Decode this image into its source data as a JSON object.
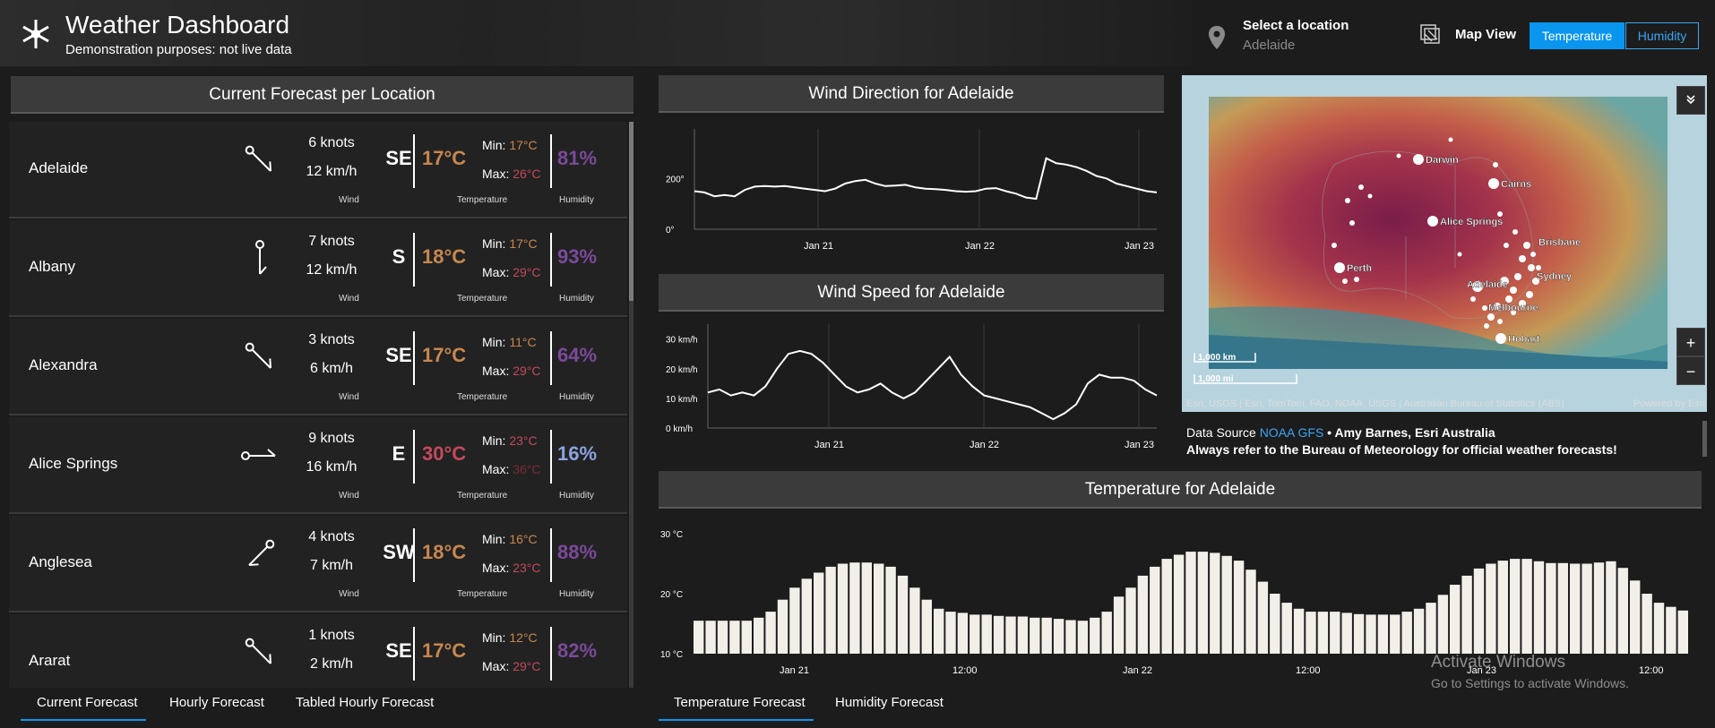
{
  "header": {
    "title": "Weather Dashboard",
    "subtitle": "Demonstration purposes: not live data",
    "logo_icon": "snowflake-sun-icon",
    "location_label": "Select a location",
    "location_value": "Adelaide",
    "map_view_label": "Map View",
    "toggle_temperature": "Temperature",
    "toggle_humidity": "Humidity",
    "accent_color": "#0a95ef"
  },
  "forecast": {
    "title": "Current Forecast per Location",
    "wind_caption": "Wind",
    "temp_caption": "Temperature",
    "hum_caption": "Humidity",
    "min_label": "Min:",
    "max_label": "Max:",
    "locations": [
      {
        "name": "Adelaide",
        "knots": "6 knots",
        "kmh": "12 km/h",
        "dir": "SE",
        "temp": "17°C",
        "min": "17°C",
        "max": "26°C",
        "hum": "81%"
      },
      {
        "name": "Albany",
        "knots": "7 knots",
        "kmh": "12 km/h",
        "dir": "S",
        "temp": "18°C",
        "min": "17°C",
        "max": "29°C",
        "hum": "93%"
      },
      {
        "name": "Alexandra",
        "knots": "3 knots",
        "kmh": "6 km/h",
        "dir": "SE",
        "temp": "17°C",
        "min": "11°C",
        "max": "29°C",
        "hum": "64%"
      },
      {
        "name": "Alice Springs",
        "knots": "9 knots",
        "kmh": "16 km/h",
        "dir": "E",
        "temp": "30°C",
        "min": "23°C",
        "max": "36°C",
        "hum": "16%"
      },
      {
        "name": "Anglesea",
        "knots": "4 knots",
        "kmh": "7 km/h",
        "dir": "SW",
        "temp": "18°C",
        "min": "16°C",
        "max": "23°C",
        "hum": "88%"
      },
      {
        "name": "Ararat",
        "knots": "1 knots",
        "kmh": "2 km/h",
        "dir": "SE",
        "temp": "17°C",
        "min": "12°C",
        "max": "29°C",
        "hum": "82%"
      }
    ]
  },
  "left_tabs": [
    "Current Forecast",
    "Hourly Forecast",
    "Tabled Hourly Forecast"
  ],
  "right_tabs": [
    "Temperature Forecast",
    "Humidity Forecast"
  ],
  "charts": {
    "wind_direction_title": "Wind Direction for Adelaide",
    "wind_speed_title": "Wind Speed for Adelaide",
    "temperature_title": "Temperature for Adelaide"
  },
  "chart_data": [
    {
      "type": "line",
      "title": "Wind Direction for Adelaide",
      "y_ticks": [
        "200°",
        "0°"
      ],
      "x_ticks": [
        "Jan 21",
        "Jan 22",
        "Jan 23"
      ],
      "ylim": [
        0,
        360
      ],
      "values": [
        150,
        145,
        130,
        135,
        130,
        155,
        168,
        170,
        168,
        170,
        165,
        160,
        155,
        150,
        160,
        180,
        190,
        195,
        180,
        170,
        172,
        175,
        165,
        160,
        158,
        155,
        150,
        148,
        150,
        160,
        162,
        150,
        140,
        125,
        120,
        280,
        260,
        255,
        245,
        230,
        210,
        200,
        180,
        170,
        160,
        150,
        145
      ]
    },
    {
      "type": "line",
      "title": "Wind Speed for Adelaide",
      "y_ticks": [
        "30 km/h",
        "20 km/h",
        "10 km/h",
        "0 km/h"
      ],
      "x_ticks": [
        "Jan 21",
        "Jan 22",
        "Jan 23"
      ],
      "ylim": [
        0,
        32
      ],
      "values": [
        12,
        13,
        11,
        12,
        11,
        14,
        20,
        25,
        26,
        25,
        22,
        18,
        14,
        12,
        13,
        15,
        12,
        10,
        12,
        16,
        20,
        24,
        18,
        14,
        11,
        10,
        9,
        8,
        7,
        5,
        3,
        5,
        8,
        15,
        18,
        17,
        17,
        16,
        13,
        11
      ]
    },
    {
      "type": "bar",
      "title": "Temperature for Adelaide",
      "y_ticks": [
        "30 °C",
        "20 °C",
        "10 °C"
      ],
      "x_ticks": [
        "Jan 21",
        "12:00",
        "Jan 22",
        "12:00",
        "Jan 23",
        "12:00"
      ],
      "ylim": [
        10,
        30
      ],
      "values": [
        15.5,
        15.5,
        15.5,
        15.5,
        15.5,
        16,
        17,
        19,
        21,
        22.5,
        23.5,
        24.5,
        25,
        25.2,
        25.2,
        25,
        24.5,
        23,
        21,
        19,
        17.5,
        17,
        16.8,
        16.5,
        16.5,
        16.3,
        16.2,
        16.2,
        16,
        16,
        15.8,
        15.6,
        15.5,
        16,
        17,
        19.5,
        21,
        23,
        24.5,
        25.8,
        26.5,
        27,
        27,
        26.8,
        26.3,
        25.5,
        24,
        22,
        20,
        18.5,
        17.5,
        17,
        17,
        17,
        16.8,
        16.6,
        16.5,
        16.5,
        16.5,
        17,
        17.5,
        18.5,
        19.8,
        21.5,
        23,
        24.2,
        25,
        25.5,
        25.8,
        25.8,
        25.4,
        25.1,
        25.1,
        25,
        25,
        25.2,
        25.4,
        24.3,
        22.2,
        20,
        18.5,
        17.8,
        17.2
      ]
    }
  ],
  "map": {
    "cities": [
      "Darwin",
      "Cairns",
      "Alice Springs",
      "Brisbane",
      "Perth",
      "Adelaide",
      "Sydney",
      "Melbourne",
      "Hobart"
    ],
    "scale_km": "1,000 km",
    "scale_mi": "1,000 mi",
    "zoom_in": "+",
    "zoom_out": "−",
    "attribution": "Esri, USGS | Esri, TomTom, FAO, NOAA, USGS | Australian Bureau of Statistics (ABS)",
    "powered_by": "Powered by Esri",
    "data_source_prefix": "Data Source ",
    "data_source_link": "NOAA GFS",
    "data_source_suffix": " • Amy Barnes, Esri Australia",
    "disclaimer": "Always refer to the Bureau of Meteorology for official weather forecasts!"
  },
  "watermark": {
    "line1": "Activate Windows",
    "line2": "Go to Settings to activate Windows."
  }
}
